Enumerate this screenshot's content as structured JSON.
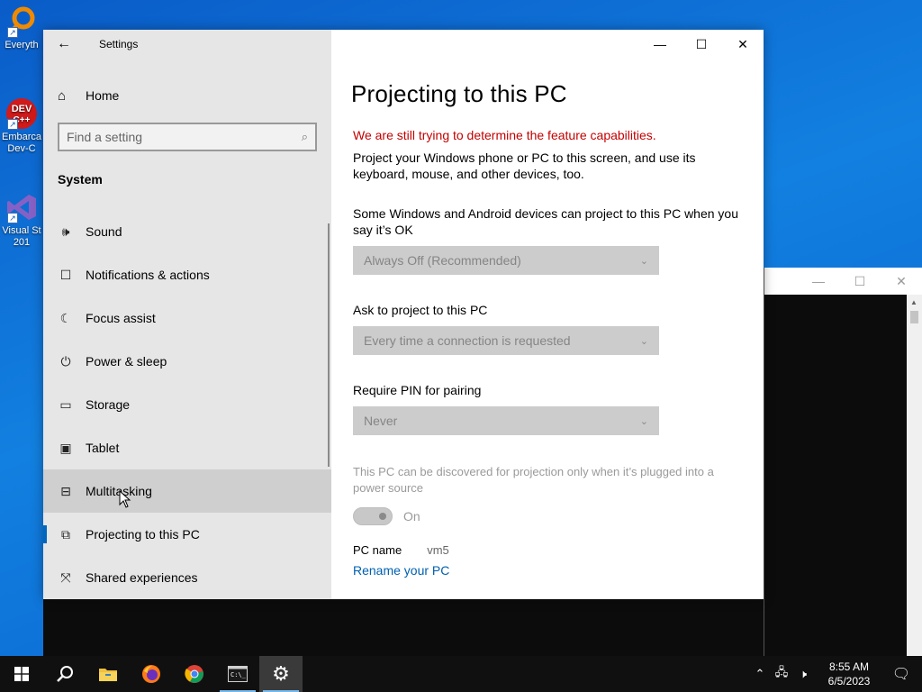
{
  "desktop": {
    "icons": [
      {
        "label": "Everyth",
        "icon": "magnifier-icon"
      },
      {
        "label": "Embarca Dev-C",
        "icon": "devcpp-icon"
      },
      {
        "label": "Visual St 201",
        "icon": "visual-studio-icon"
      }
    ]
  },
  "settings": {
    "window_title": "Settings",
    "home_label": "Home",
    "search_placeholder": "Find a setting",
    "section": "System",
    "nav_items": [
      {
        "label": "Sound",
        "icon": "speaker-icon"
      },
      {
        "label": "Notifications & actions",
        "icon": "notification-icon"
      },
      {
        "label": "Focus assist",
        "icon": "moon-icon"
      },
      {
        "label": "Power & sleep",
        "icon": "power-icon"
      },
      {
        "label": "Storage",
        "icon": "storage-icon"
      },
      {
        "label": "Tablet",
        "icon": "tablet-icon"
      },
      {
        "label": "Multitasking",
        "icon": "multitasking-icon"
      },
      {
        "label": "Projecting to this PC",
        "icon": "projecting-icon"
      },
      {
        "label": "Shared experiences",
        "icon": "shared-icon"
      }
    ],
    "page": {
      "title": "Projecting to this PC",
      "warning": "We are still trying to determine the feature capabilities.",
      "description": "Project your Windows phone or PC to this screen, and use its keyboard, mouse, and other devices, too.",
      "availability_label": "Some Windows and Android devices can project to this PC when you say it’s OK",
      "availability_value": "Always Off (Recommended)",
      "ask_label": "Ask to project to this PC",
      "ask_value": "Every time a connection is requested",
      "pin_label": "Require PIN for pairing",
      "pin_value": "Never",
      "power_text": "This PC can be discovered for projection only when it’s plugged into a power source",
      "toggle_label": "On",
      "toggle_on": true,
      "pc_name_label": "PC name",
      "pc_name_value": "vm5",
      "rename_link": "Rename your PC"
    }
  },
  "taskbar": {
    "apps": [
      "start-icon",
      "search-icon",
      "file-explorer-icon",
      "firefox-icon",
      "chrome-icon",
      "terminal-icon",
      "settings-icon"
    ],
    "time": "8:55 AM",
    "date": "6/5/2023"
  },
  "colors": {
    "accent": "#0067c0",
    "warning": "#c50000",
    "link": "#0060b0"
  }
}
